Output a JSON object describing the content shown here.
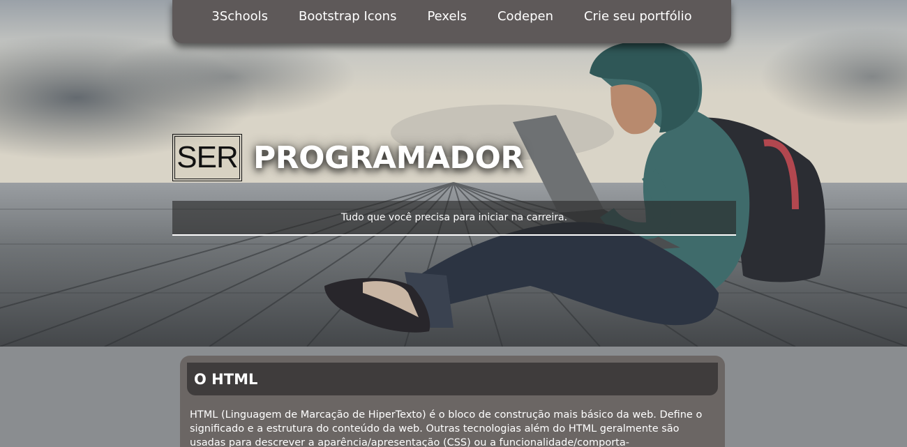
{
  "nav": {
    "items": [
      {
        "label": "3Schools"
      },
      {
        "label": "Bootstrap Icons"
      },
      {
        "label": "Pexels"
      },
      {
        "label": "Codepen"
      },
      {
        "label": "Crie seu portfólio"
      }
    ]
  },
  "hero": {
    "title_boxed": "SER",
    "title_rest": "PROGRAMADOR",
    "tagline": "Tudo que você precisa para iniciar na carreira."
  },
  "section": {
    "heading": "O HTML",
    "paragraph": "HTML (Linguagem de Marcação de HiperTexto) é o bloco de construção mais básico da web. Define o significado e a estrutura do conteúdo da web. Outras tecnologias além do HTML geralmente são usadas para descrever a aparência/apresentação (CSS) ou a funcionalidade/comporta-"
  },
  "colors": {
    "nav_bg": "#5e5959",
    "card_bg": "#6b6664",
    "card_head_bg": "#3f3c3c",
    "page_bg": "#8a8d90"
  }
}
